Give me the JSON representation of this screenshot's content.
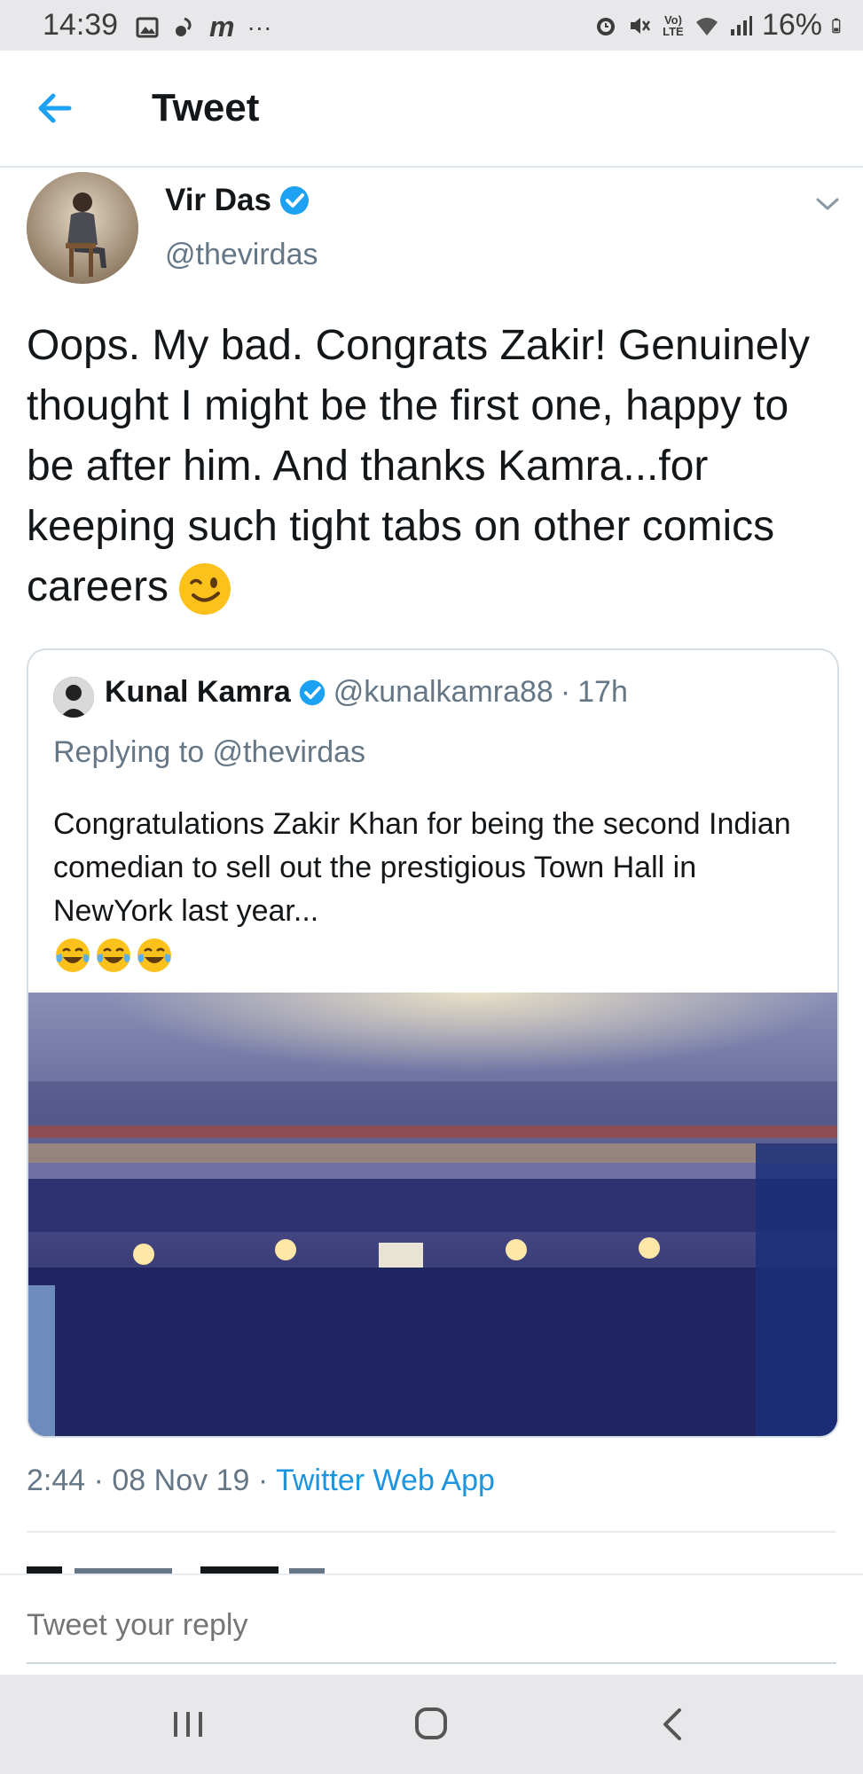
{
  "status_bar": {
    "time": "14:39",
    "battery": "16%",
    "net_label": "Vo) LTE",
    "m_glyph": "m",
    "more_glyph": "···",
    "icons": [
      "gallery-icon",
      "notification-icon",
      "m-app-icon",
      "more-icon",
      "alarm-icon",
      "mute-icon",
      "volte-icon",
      "wifi-icon",
      "signal-icon",
      "battery-icon"
    ]
  },
  "header": {
    "title": "Tweet",
    "back_icon": "back-arrow-icon"
  },
  "tweet": {
    "author_name": "Vir Das",
    "author_handle": "@thevirdas",
    "verified": true,
    "text": "Oops. My bad. Congrats Zakir! Genuinely thought I might be the first one, happy to be after him. And thanks Kamra...for keeping such tight tabs on other comics careers",
    "emoji": "winking-face",
    "timestamp": "2:44 · 08 Nov 19 · ",
    "source": "Twitter Web App"
  },
  "quote": {
    "author_name": "Kunal Kamra",
    "author_handle": "@kunalkamra88",
    "separator": "·",
    "time": "17h",
    "replying_to": "Replying to @thevirdas",
    "text": "Congratulations Zakir Khan for being the second Indian comedian to sell out the prestigious Town Hall in NewYork last year...",
    "emojis": [
      "face-with-tears-of-joy",
      "face-with-tears-of-joy",
      "face-with-tears-of-joy"
    ],
    "media": "theater-audience-photo"
  },
  "reply": {
    "placeholder": "Tweet your reply"
  },
  "nav": {
    "items": [
      "recent-apps-icon",
      "home-icon",
      "back-icon"
    ]
  },
  "colors": {
    "accent": "#1da1f2",
    "secondary_text": "#657786",
    "primary_text": "#14171a",
    "system_bar": "#e8e8ea"
  }
}
